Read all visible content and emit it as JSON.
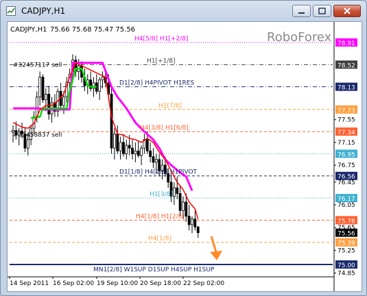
{
  "window": {
    "title": "CADJPY,H1"
  },
  "chart_header": {
    "symbol_tf": "CADJPY,H1",
    "ohlc": "75.66 75.68 75.47 75.56"
  },
  "watermark": "RoboForex",
  "colors": {
    "magenta_line": "#ff00ff",
    "green_line": "#00e000",
    "red_line": "#ff0000",
    "candles": "#000000",
    "arrow": "#ff8c28"
  },
  "chart_data": {
    "type": "candlestick",
    "symbol": "CADJPY",
    "timeframe": "H1",
    "ylim": [
      74.7,
      79.0
    ],
    "y_ticks": [
      78.91,
      78.52,
      78.13,
      77.73,
      77.34,
      76.95,
      76.56,
      76.17,
      75.78,
      75.56,
      75.39,
      75.0,
      77.55,
      77.15,
      76.75,
      76.45,
      76.05,
      75.65,
      75.25,
      74.85
    ],
    "price_badges": [
      {
        "value": "78.91",
        "bg": "#ff00ff",
        "fg": "#ffffff"
      },
      {
        "value": "78.52",
        "bg": "#404040",
        "fg": "#ffffff"
      },
      {
        "value": "78.13",
        "bg": "#1a2a6c",
        "fg": "#ffffff"
      },
      {
        "value": "77.73",
        "bg": "#ffa040",
        "fg": "#ffffff"
      },
      {
        "value": "77.34",
        "bg": "#ff6030",
        "fg": "#ffffff"
      },
      {
        "value": "76.95",
        "bg": "#40b0d0",
        "fg": "#ffffff"
      },
      {
        "value": "76.56",
        "bg": "#1a2a6c",
        "fg": "#ffffff"
      },
      {
        "value": "76.17",
        "bg": "#40b0d0",
        "fg": "#ffffff"
      },
      {
        "value": "75.78",
        "bg": "#ff6030",
        "fg": "#ffffff"
      },
      {
        "value": "75.56",
        "bg": "#000000",
        "fg": "#ffffff"
      },
      {
        "value": "75.39",
        "bg": "#ffa040",
        "fg": "#ffffff"
      },
      {
        "value": "75.00",
        "bg": "#1a2a6c",
        "fg": "#ffffff"
      }
    ],
    "plain_ticks": [
      "77.55",
      "77.15",
      "76.75",
      "76.45",
      "76.05",
      "75.65",
      "75.25",
      "74.85"
    ],
    "x_labels": [
      "14 Sep 2011",
      "16 Sep 02:00",
      "19 Sep 10:00",
      "20 Sep 18:00",
      "22 Sep 02:00"
    ],
    "levels": [
      {
        "price": 78.91,
        "label": "H4[5/8] H1[+2/8]",
        "color": "#ff00ff",
        "style": "dot"
      },
      {
        "price": 78.52,
        "label": "H1[+1/8]",
        "color": "#404040",
        "style": "dashdot"
      },
      {
        "price": 78.13,
        "label": "D1[2/8] H4PIVOT H1RES",
        "color": "#1a2a6c",
        "style": "dashdot"
      },
      {
        "price": 77.73,
        "label": "H1[7/8]",
        "color": "#ffa040",
        "style": "dash"
      },
      {
        "price": 77.34,
        "label": "H4[3/8] H1[6/8]",
        "color": "#ff6030",
        "style": "dash"
      },
      {
        "price": 76.95,
        "label": "",
        "color": "#40b0d0",
        "style": "dot"
      },
      {
        "price": 76.56,
        "label": "D1[1/8] H4[2/8] H1PIVOT",
        "color": "#1a2a6c",
        "style": "dash"
      },
      {
        "price": 76.17,
        "label": "H1[3/8]",
        "color": "#40b0d0",
        "style": "dot"
      },
      {
        "price": 75.78,
        "label": "H4[1/8] H1[2/8]",
        "color": "#ff6030",
        "style": "dash"
      },
      {
        "price": 75.39,
        "label": "H4[1/8]",
        "color": "#ffa040",
        "style": "dash"
      },
      {
        "price": 75.0,
        "label": "MN1[2/8] W1SUP D1SUP H4SUP H1SUP",
        "color": "#1a2a6c",
        "style": "solid"
      }
    ],
    "order_labels": [
      {
        "text": "#32457117 sell",
        "price": 78.48
      },
      {
        "text": "#32458837 sell",
        "price": 77.25
      }
    ],
    "candles": [
      [
        77.33,
        77.45,
        77.15,
        77.36
      ],
      [
        77.36,
        77.52,
        77.2,
        77.28
      ],
      [
        77.28,
        77.4,
        77.1,
        77.35
      ],
      [
        77.35,
        77.5,
        77.22,
        77.3
      ],
      [
        77.3,
        77.42,
        76.98,
        77.05
      ],
      [
        77.05,
        77.3,
        76.92,
        77.2
      ],
      [
        77.2,
        77.46,
        77.1,
        77.4
      ],
      [
        77.4,
        77.7,
        77.3,
        77.6
      ],
      [
        77.6,
        78.05,
        77.5,
        77.95
      ],
      [
        77.95,
        78.4,
        77.8,
        78.3
      ],
      [
        78.3,
        78.35,
        77.85,
        77.9
      ],
      [
        77.9,
        78.1,
        77.7,
        78.0
      ],
      [
        78.0,
        78.15,
        77.55,
        77.65
      ],
      [
        77.65,
        77.95,
        77.5,
        77.85
      ],
      [
        77.85,
        78.0,
        77.6,
        77.7
      ],
      [
        77.7,
        78.1,
        77.6,
        78.05
      ],
      [
        78.05,
        78.2,
        77.75,
        77.8
      ],
      [
        77.8,
        78.05,
        77.65,
        77.95
      ],
      [
        77.95,
        78.3,
        77.85,
        78.2
      ],
      [
        78.2,
        78.45,
        78.05,
        78.35
      ],
      [
        78.35,
        78.7,
        78.2,
        78.6
      ],
      [
        78.6,
        78.68,
        78.3,
        78.4
      ],
      [
        78.4,
        78.62,
        78.25,
        78.5
      ],
      [
        78.5,
        78.58,
        78.2,
        78.3
      ],
      [
        78.3,
        78.45,
        78.05,
        78.15
      ],
      [
        78.15,
        78.35,
        78.0,
        78.25
      ],
      [
        78.25,
        78.4,
        78.05,
        78.1
      ],
      [
        78.1,
        78.3,
        77.95,
        78.2
      ],
      [
        78.2,
        78.35,
        78.0,
        78.05
      ],
      [
        78.05,
        78.3,
        77.9,
        78.25
      ],
      [
        78.25,
        78.4,
        78.1,
        78.3
      ],
      [
        78.3,
        78.42,
        78.12,
        78.2
      ],
      [
        78.2,
        78.35,
        77.9,
        78.0
      ],
      [
        78.0,
        78.1,
        76.95,
        77.05
      ],
      [
        77.05,
        77.4,
        76.85,
        77.3
      ],
      [
        77.3,
        77.45,
        76.95,
        77.0
      ],
      [
        77.0,
        77.25,
        76.85,
        77.15
      ],
      [
        77.15,
        77.3,
        76.9,
        76.95
      ],
      [
        76.95,
        77.2,
        76.85,
        77.1
      ],
      [
        77.1,
        77.28,
        76.92,
        77.05
      ],
      [
        77.05,
        77.2,
        76.85,
        76.95
      ],
      [
        76.95,
        77.15,
        76.8,
        77.0
      ],
      [
        77.0,
        77.18,
        76.88,
        76.92
      ],
      [
        76.92,
        77.1,
        76.75,
        77.05
      ],
      [
        77.05,
        77.3,
        76.95,
        77.2
      ],
      [
        77.2,
        77.35,
        76.95,
        77.0
      ],
      [
        77.0,
        77.15,
        76.8,
        76.9
      ],
      [
        76.9,
        77.05,
        76.7,
        76.8
      ],
      [
        76.8,
        76.95,
        76.6,
        76.85
      ],
      [
        76.85,
        76.95,
        76.55,
        76.65
      ],
      [
        76.65,
        76.85,
        76.5,
        76.75
      ],
      [
        76.75,
        76.9,
        76.55,
        76.6
      ],
      [
        76.6,
        76.7,
        76.35,
        76.45
      ],
      [
        76.45,
        76.6,
        76.1,
        76.2
      ],
      [
        76.2,
        76.45,
        76.05,
        76.35
      ],
      [
        76.35,
        76.55,
        76.15,
        76.25
      ],
      [
        76.25,
        76.4,
        75.85,
        75.95
      ],
      [
        75.95,
        76.2,
        75.8,
        76.1
      ],
      [
        76.1,
        76.25,
        75.75,
        75.85
      ],
      [
        75.85,
        76.05,
        75.6,
        75.7
      ],
      [
        75.7,
        75.85,
        75.55,
        75.8
      ],
      [
        75.8,
        75.95,
        75.6,
        75.66
      ],
      [
        75.66,
        75.68,
        75.47,
        75.56
      ]
    ],
    "magenta_line": [
      [
        0,
        77.75
      ],
      [
        9,
        77.75
      ],
      [
        10,
        77.73
      ],
      [
        19,
        77.73
      ],
      [
        20,
        78.55
      ],
      [
        30,
        78.55
      ],
      [
        33,
        78.13
      ],
      [
        35,
        77.95
      ],
      [
        38,
        77.75
      ],
      [
        41,
        77.5
      ],
      [
        44,
        77.34
      ],
      [
        47,
        77.2
      ],
      [
        49,
        77.05
      ],
      [
        51,
        76.85
      ],
      [
        53,
        76.75
      ],
      [
        56,
        76.62
      ],
      [
        58,
        76.55
      ],
      [
        60,
        76.3
      ]
    ],
    "green_line": [
      [
        6,
        77.58
      ],
      [
        9,
        77.6
      ],
      [
        10,
        77.75
      ],
      [
        18,
        77.75
      ],
      [
        19,
        78.05
      ],
      [
        21,
        78.45
      ],
      [
        23,
        78.45
      ],
      [
        25,
        78.15
      ],
      [
        26,
        78.13
      ],
      [
        28,
        78.13
      ]
    ],
    "red_line": [
      [
        0,
        77.5
      ],
      [
        3,
        77.42
      ],
      [
        5,
        77.4
      ],
      [
        7,
        77.48
      ],
      [
        9,
        77.72
      ],
      [
        11,
        77.8
      ],
      [
        13,
        77.8
      ],
      [
        15,
        77.88
      ],
      [
        17,
        78.0
      ],
      [
        19,
        78.3
      ],
      [
        21,
        78.55
      ],
      [
        23,
        78.5
      ],
      [
        25,
        78.45
      ],
      [
        27,
        78.4
      ],
      [
        29,
        78.35
      ],
      [
        31,
        78.3
      ],
      [
        33,
        77.6
      ],
      [
        35,
        77.3
      ],
      [
        37,
        77.28
      ],
      [
        39,
        77.22
      ],
      [
        41,
        77.2
      ],
      [
        43,
        77.15
      ],
      [
        45,
        77.22
      ],
      [
        47,
        77.15
      ],
      [
        49,
        76.98
      ],
      [
        51,
        76.85
      ],
      [
        53,
        76.65
      ],
      [
        55,
        76.45
      ],
      [
        57,
        76.32
      ],
      [
        59,
        76.1
      ],
      [
        61,
        75.98
      ],
      [
        62,
        75.8
      ]
    ],
    "arrow": {
      "from_price": 75.4,
      "to_price": 75.05,
      "candle_index": 69
    }
  }
}
